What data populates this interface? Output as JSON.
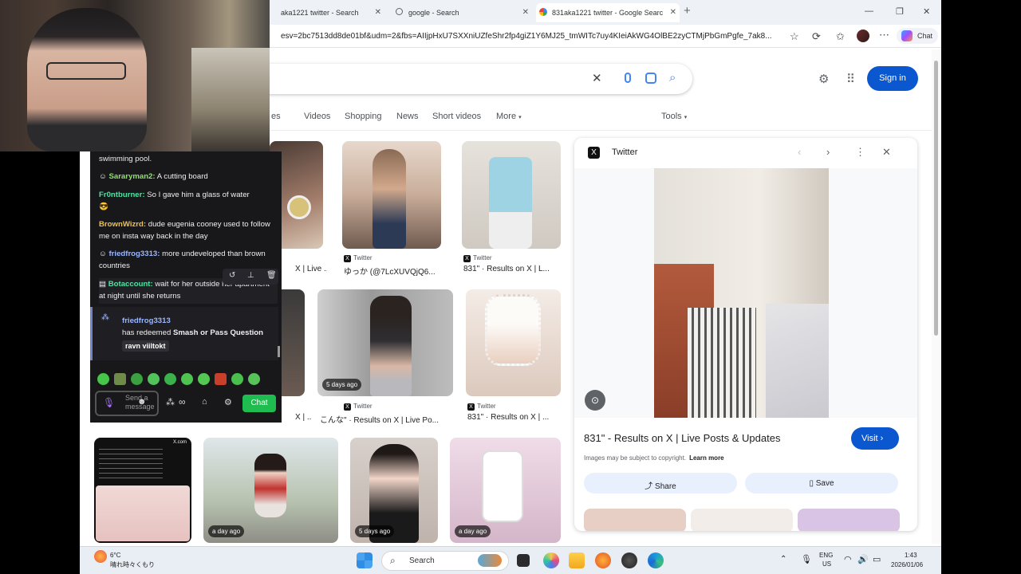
{
  "browser": {
    "tabs": [
      {
        "label": "aka1221 twitter - Search"
      },
      {
        "label": "google - Search"
      },
      {
        "label": "831aka1221 twitter - Google Searc"
      }
    ],
    "new_tab": "+",
    "url": "esv=2bc7513dd8de01bf&udm=2&fbs=AIIjpHxU7SXXniUZfeShr2fp4giZ1Y6MJ25_tmWITc7uy4KIeiAkWG4OlBE2zyCTMjPbGmPgfe_7ak8...",
    "copilot_label": "Chat"
  },
  "google": {
    "signin_label": "Sign in",
    "filters": [
      "es",
      "Videos",
      "Shopping",
      "News",
      "Short videos",
      "More"
    ],
    "tools_label": "Tools",
    "results": [
      {
        "source": "Twitter",
        "title": "X | Live ..."
      },
      {
        "source": "Twitter",
        "title": "ゆっか (@7LcXUVQjQ6..."
      },
      {
        "source": "Twitter",
        "title": "831\" · Results on X | L..."
      },
      {
        "source": "Twitter",
        "title": "X | ..."
      },
      {
        "source": "Twitter",
        "title": "こんな\" · Results on X | Live Po...",
        "badge": "5 days ago"
      },
      {
        "source": "Twitter",
        "title": "831\" · Results on X | ..."
      }
    ],
    "bottom_badges": [
      "a day ago",
      "5 days ago",
      "a day ago"
    ],
    "card_caption": "X.com"
  },
  "panel": {
    "source": "Twitter",
    "title": "831\" - Results on X | Live Posts & Updates",
    "visit_label": "Visit",
    "copyright": "Images may be subject to copyright.",
    "learn_more": "Learn more",
    "share_label": "Share",
    "save_label": "Save"
  },
  "chat": {
    "messages": [
      {
        "user": "",
        "text": "swimming pool."
      },
      {
        "user": "Sararyman2:",
        "text": " A cutting board"
      },
      {
        "user": "Fr0ntburner:",
        "text": " So I gave him a glass of water"
      },
      {
        "user": "BrownWizrd:",
        "text": " dude eugenia cooney used to follow me on insta way back in the day"
      },
      {
        "user": "friedfrog3313:",
        "text": " more undeveloped than brown countries"
      },
      {
        "user": "Botaccount:",
        "text": " wait for her outside her apartment at night until she returns"
      }
    ],
    "redeem": {
      "user": "friedfrog3313",
      "action": "has redeemed ",
      "reward": "Smash or Pass Question",
      "input": "ravn viiltokt"
    },
    "input_placeholder": "Send a message",
    "chat_button": "Chat",
    "points": "∞"
  },
  "taskbar": {
    "weather_temp": "6°C",
    "weather_text": "晴れ時々くもり",
    "search_label": "Search",
    "lang": "ENG",
    "region": "US",
    "time": "1:43",
    "date": "2026/01/06"
  }
}
